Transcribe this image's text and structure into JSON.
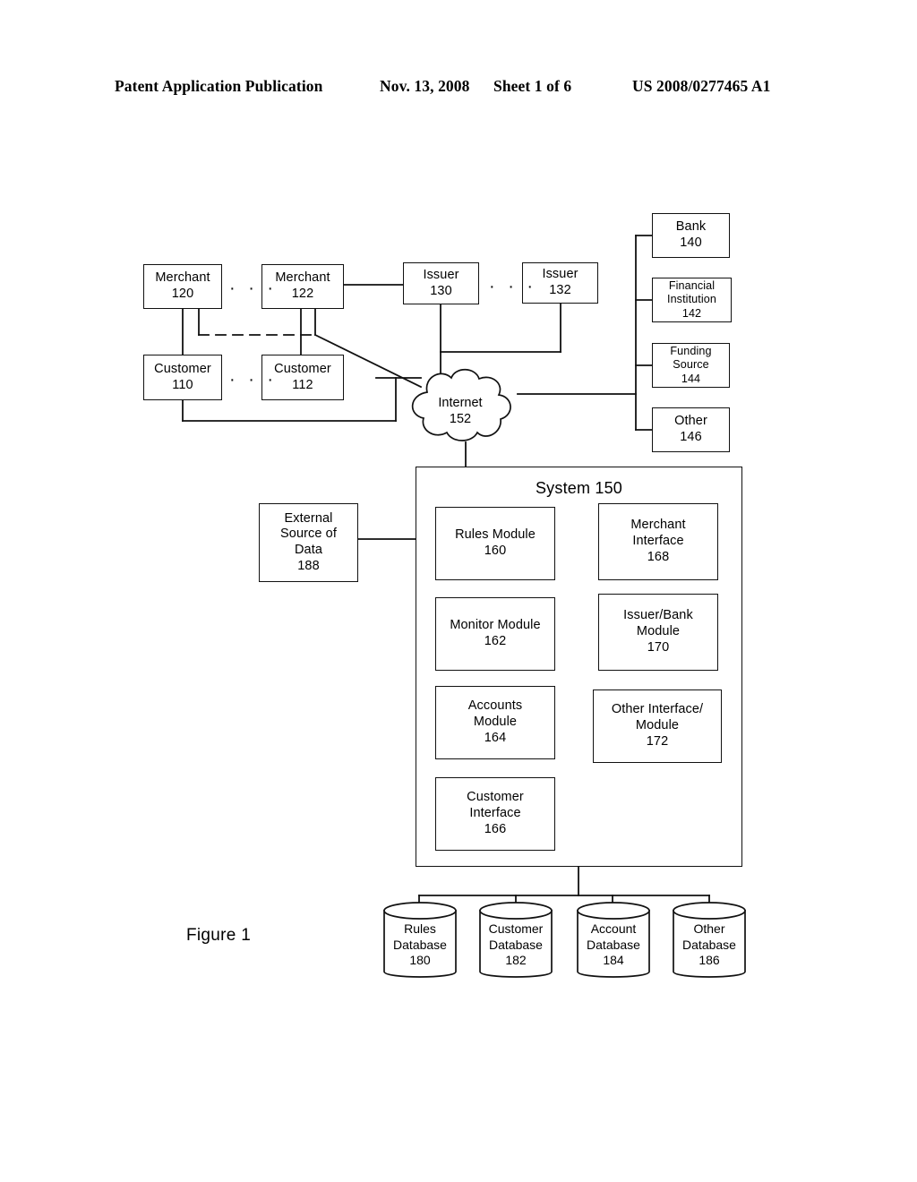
{
  "header": {
    "publication": "Patent Application Publication",
    "date": "Nov. 13, 2008",
    "sheet": "Sheet 1 of 6",
    "patent_number": "US 2008/0277465 A1"
  },
  "figure": {
    "caption": "Figure 1"
  },
  "nodes": {
    "merchant_120": {
      "line1": "Merchant",
      "line2": "120"
    },
    "merchant_122": {
      "line1": "Merchant",
      "line2": "122"
    },
    "customer_110": {
      "line1": "Customer",
      "line2": "110"
    },
    "customer_112": {
      "line1": "Customer",
      "line2": "112"
    },
    "issuer_130": {
      "line1": "Issuer",
      "line2": "130"
    },
    "issuer_132": {
      "line1": "Issuer",
      "line2": "132"
    },
    "bank_140": {
      "line1": "Bank",
      "line2": "140"
    },
    "financial_institution_142": {
      "line1": "Financial",
      "line2": "Institution",
      "line3": "142"
    },
    "funding_source_144": {
      "line1": "Funding",
      "line2": "Source",
      "line3": "144"
    },
    "other_146": {
      "line1": "Other",
      "line2": "146"
    },
    "internet_152": {
      "line1": "Internet",
      "line2": "152"
    },
    "external_source_188": {
      "line1": "External",
      "line2": "Source of",
      "line3": "Data",
      "line4": "188"
    },
    "system_150": {
      "title": "System 150"
    },
    "rules_module_160": {
      "line1": "Rules Module",
      "line2": "160"
    },
    "monitor_module_162": {
      "line1": "Monitor Module",
      "line2": "162"
    },
    "accounts_module_164": {
      "line1": "Accounts",
      "line2": "Module",
      "line3": "164"
    },
    "customer_interface_166": {
      "line1": "Customer",
      "line2": "Interface",
      "line3": "166"
    },
    "merchant_interface_168": {
      "line1": "Merchant",
      "line2": "Interface",
      "line3": "168"
    },
    "issuer_bank_module_170": {
      "line1": "Issuer/Bank",
      "line2": "Module",
      "line3": "170"
    },
    "other_interface_module_172": {
      "line1": "Other Interface/",
      "line2": "Module",
      "line3": "172"
    },
    "rules_database_180": {
      "line1": "Rules",
      "line2": "Database",
      "line3": "180"
    },
    "customer_database_182": {
      "line1": "Customer",
      "line2": "Database",
      "line3": "182"
    },
    "account_database_184": {
      "line1": "Account",
      "line2": "Database",
      "line3": "184"
    },
    "other_database_186": {
      "line1": "Other",
      "line2": "Database",
      "line3": "186"
    }
  },
  "ellipses": {
    "merchants": "· · ·",
    "customers": "· · ·",
    "issuers": "· · ·"
  },
  "colors": {
    "ink": "#111111",
    "paper": "#ffffff"
  }
}
